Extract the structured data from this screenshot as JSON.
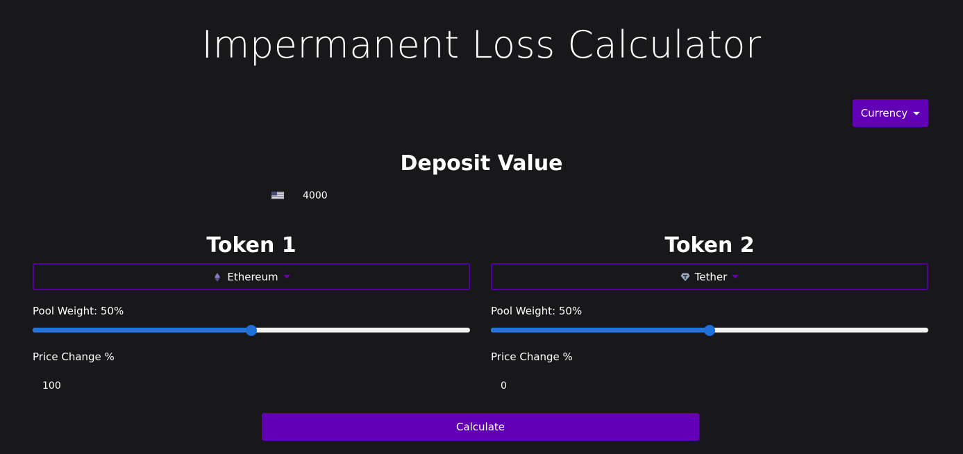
{
  "title": "Impermanent Loss Calculator",
  "currency_button": {
    "label": "Currency",
    "icon": "caret-down-icon"
  },
  "deposit": {
    "heading": "Deposit Value",
    "currency_icon": "us-flag-icon",
    "value": "4000"
  },
  "tokens": [
    {
      "heading": "Token 1",
      "selected": "Ethereum",
      "icon": "ethereum-icon",
      "pool_weight_label": "Pool Weight: 50%",
      "pool_weight_fraction": 0.5,
      "price_change_label": "Price Change %",
      "price_change_value": "100"
    },
    {
      "heading": "Token 2",
      "selected": "Tether",
      "icon": "tether-icon",
      "pool_weight_label": "Pool Weight: 50%",
      "pool_weight_fraction": 0.5,
      "price_change_label": "Price Change %",
      "price_change_value": "0"
    }
  ],
  "calculate_button": {
    "label": "Calculate"
  },
  "colors": {
    "background": "#18181a",
    "accent": "#6200b5",
    "slider_fill": "#2575d8"
  }
}
